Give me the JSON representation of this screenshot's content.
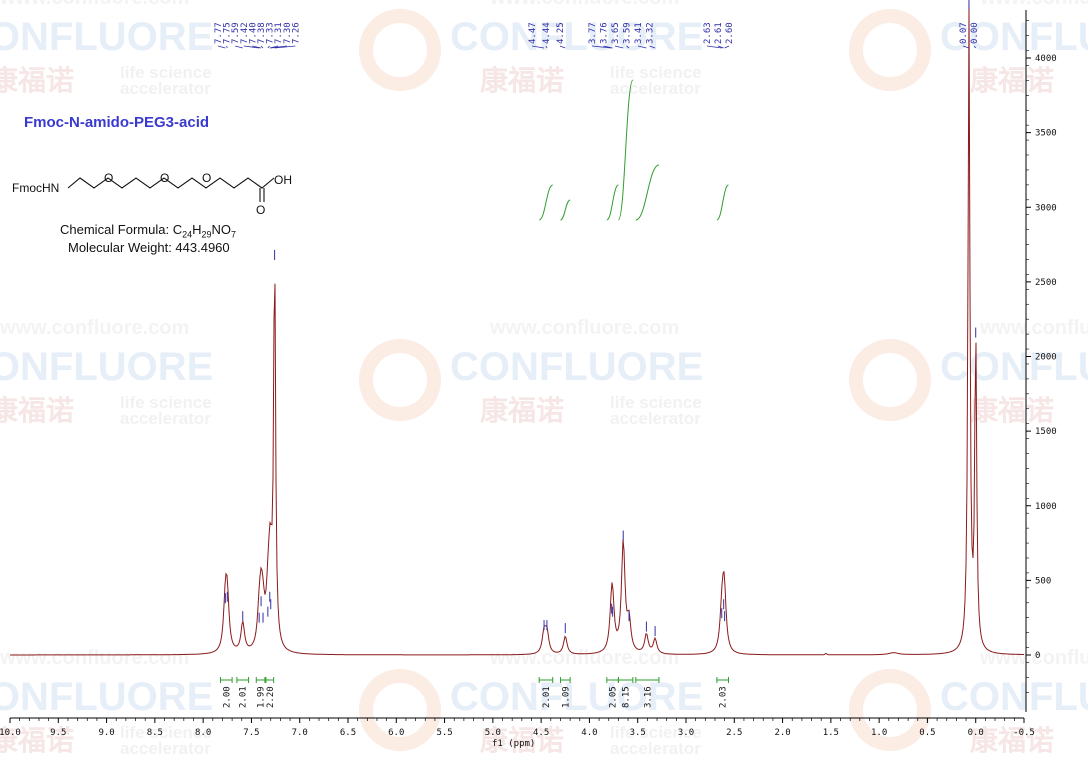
{
  "watermark": {
    "url": "www.confluore.com",
    "brand": "CONFLUORE",
    "chinese": "康福诺",
    "tagline_1": "life science",
    "tagline_2": "accelerator"
  },
  "compound": {
    "title": "Fmoc-N-amido-PEG3-acid",
    "structure_left_label": "FmocHN",
    "structure_oh_label": "OH",
    "structure_o_label": "O",
    "formula_prefix": "Chemical Formula: ",
    "formula": "C24H29NO7",
    "mw_text": "Molecular Weight: 443.4960"
  },
  "colors": {
    "spectrum": "#8b1a1a",
    "peak_label": "#2f2fa8",
    "integral": "#2e9e2e",
    "axis": "#000000"
  },
  "chart_data": {
    "type": "line",
    "title": "Fmoc-N-amido-PEG3-acid",
    "xlabel": "f1 (ppm)",
    "ylabel": "",
    "xlim": [
      10.0,
      -0.5
    ],
    "ylim": [
      -300,
      4300
    ],
    "x_reversed": true,
    "x_ticks": [
      "10.0",
      "9.5",
      "9.0",
      "8.5",
      "8.0",
      "7.5",
      "7.0",
      "6.5",
      "6.0",
      "5.5",
      "5.0",
      "4.5",
      "4.0",
      "3.5",
      "3.0",
      "2.5",
      "2.0",
      "1.5",
      "1.0",
      "0.5",
      "0.0",
      "-0.5"
    ],
    "y_ticks": [
      0,
      500,
      1000,
      1500,
      2000,
      2500,
      3000,
      3500,
      4000
    ],
    "peaks": [
      {
        "x": 7.77,
        "y": 320
      },
      {
        "x": 7.75,
        "y": 330
      },
      {
        "x": 7.59,
        "y": 200
      },
      {
        "x": 7.42,
        "y": 190
      },
      {
        "x": 7.4,
        "y": 300
      },
      {
        "x": 7.38,
        "y": 190
      },
      {
        "x": 7.33,
        "y": 230
      },
      {
        "x": 7.31,
        "y": 330
      },
      {
        "x": 7.3,
        "y": 280
      },
      {
        "x": 7.26,
        "y": 2620
      },
      {
        "x": 4.47,
        "y": 140
      },
      {
        "x": 4.44,
        "y": 140
      },
      {
        "x": 4.25,
        "y": 120
      },
      {
        "x": 3.77,
        "y": 250
      },
      {
        "x": 3.76,
        "y": 230
      },
      {
        "x": 3.65,
        "y": 740
      },
      {
        "x": 3.59,
        "y": 200
      },
      {
        "x": 3.41,
        "y": 130
      },
      {
        "x": 3.32,
        "y": 100
      },
      {
        "x": 2.63,
        "y": 220
      },
      {
        "x": 2.61,
        "y": 280
      },
      {
        "x": 2.6,
        "y": 200
      },
      {
        "x": 0.07,
        "y": 4300
      },
      {
        "x": 0.0,
        "y": 2100
      }
    ],
    "peak_labels": [
      "7.77",
      "7.75",
      "7.59",
      "7.42",
      "7.40",
      "7.38",
      "7.33",
      "7.31",
      "7.30",
      "7.26",
      "4.47",
      "4.44",
      "4.25",
      "3.77",
      "3.76",
      "3.65",
      "3.59",
      "3.41",
      "3.32",
      "2.63",
      "2.61",
      "2.60",
      "0.07",
      "0.00"
    ],
    "integrals": [
      {
        "from": 7.82,
        "to": 7.7,
        "value": "2.00"
      },
      {
        "from": 7.65,
        "to": 7.53,
        "value": "2.01"
      },
      {
        "from": 7.45,
        "to": 7.36,
        "value": "1.99"
      },
      {
        "from": 7.35,
        "to": 7.27,
        "value": "2.20"
      },
      {
        "from": 4.52,
        "to": 4.38,
        "value": "2.01"
      },
      {
        "from": 4.3,
        "to": 4.2,
        "value": "1.09"
      },
      {
        "from": 3.82,
        "to": 3.7,
        "value": "2.05"
      },
      {
        "from": 3.7,
        "to": 3.55,
        "value": "8.15"
      },
      {
        "from": 3.52,
        "to": 3.28,
        "value": "3.16"
      },
      {
        "from": 2.68,
        "to": 2.56,
        "value": "2.03"
      }
    ],
    "grid": false,
    "legend": "none"
  }
}
